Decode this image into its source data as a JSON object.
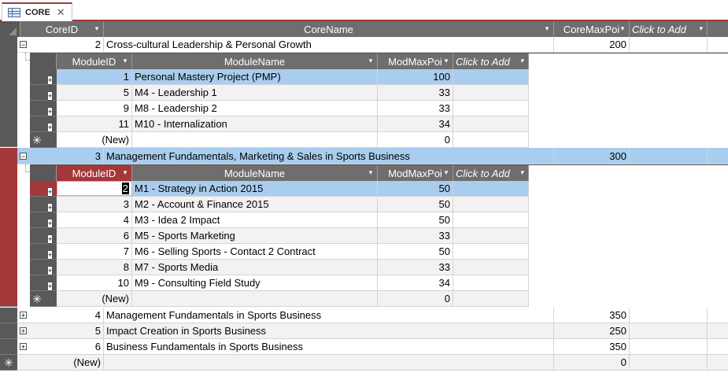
{
  "tab": {
    "label": "CORE"
  },
  "core_headers": {
    "id": "CoreID",
    "name": "CoreName",
    "max": "CoreMaxPoi",
    "add": "Click to Add"
  },
  "module_headers": {
    "id": "ModuleID",
    "name": "ModuleName",
    "max": "ModMaxPoi",
    "add": "Click to Add"
  },
  "core_rows": [
    {
      "id": "2",
      "name": "Cross-cultural Leadership & Personal Growth",
      "max": "200",
      "expanded": true
    },
    {
      "id": "3",
      "name": "Management Fundamentals, Marketing & Sales in Sports Business",
      "max": "300",
      "expanded": true
    },
    {
      "id": "4",
      "name": "Management Fundamentals in Sports Business",
      "max": "350",
      "expanded": false
    },
    {
      "id": "5",
      "name": "Impact Creation in Sports Business",
      "max": "250",
      "expanded": false
    },
    {
      "id": "6",
      "name": "Business Fundamentals in Sports Business",
      "max": "350",
      "expanded": false
    }
  ],
  "sub1": [
    {
      "id": "1",
      "name": "Personal Mastery Project (PMP)",
      "max": "100"
    },
    {
      "id": "5",
      "name": "M4 - Leadership 1",
      "max": "33"
    },
    {
      "id": "9",
      "name": "M8 - Leadership 2",
      "max": "33"
    },
    {
      "id": "11",
      "name": "M10 - Internalization",
      "max": "34"
    }
  ],
  "sub2": [
    {
      "id": "2",
      "name": "M1 - Strategy in Action 2015",
      "max": "50"
    },
    {
      "id": "3",
      "name": "M2 - Account & Finance 2015",
      "max": "50"
    },
    {
      "id": "4",
      "name": "M3 - Idea 2 Impact",
      "max": "50"
    },
    {
      "id": "6",
      "name": "M5 - Sports Marketing",
      "max": "33"
    },
    {
      "id": "7",
      "name": "M6 - Selling Sports - Contact 2 Contract",
      "max": "50"
    },
    {
      "id": "8",
      "name": "M7 - Sports Media",
      "max": "33"
    },
    {
      "id": "10",
      "name": "M9 - Consulting Field Study",
      "max": "34"
    }
  ],
  "new_row": {
    "label": "(New)",
    "max": "0"
  },
  "glyphs": {
    "expand": "+",
    "collapse": "−",
    "new": "✳",
    "close": "✕",
    "dropdown": "▾"
  }
}
